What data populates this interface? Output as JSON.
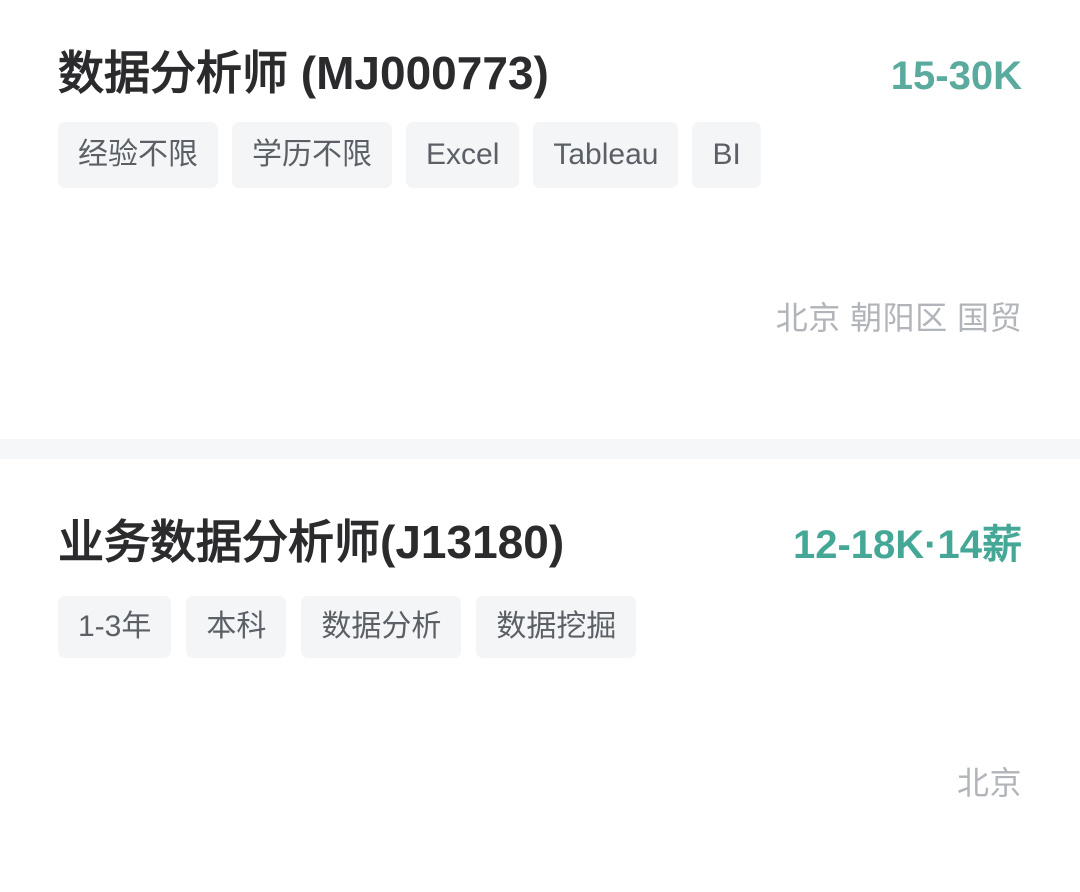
{
  "page": {
    "background_color": "#ffffff",
    "divider_color": "#f6f7f8"
  },
  "colors": {
    "title_text": "#2b2b2d",
    "salary_accent_1": "#5aab9e",
    "salary_accent_2": "#45a897",
    "tag_background": "#f4f5f6",
    "tag_text": "#5b6066",
    "location_text": "#b1b4b9"
  },
  "jobs": [
    {
      "title": "数据分析师 (MJ000773)",
      "salary": "15-30K",
      "tags": [
        {
          "label": "经验不限"
        },
        {
          "label": "学历不限"
        },
        {
          "label": "Excel"
        },
        {
          "label": "Tableau"
        },
        {
          "label": "BI"
        }
      ],
      "location": "北京 朝阳区 国贸"
    },
    {
      "title": "业务数据分析师(J13180)",
      "salary": "12-18K·14薪",
      "tags": [
        {
          "label": "1-3年"
        },
        {
          "label": "本科"
        },
        {
          "label": "数据分析"
        },
        {
          "label": "数据挖掘"
        }
      ],
      "location": "北京"
    }
  ]
}
